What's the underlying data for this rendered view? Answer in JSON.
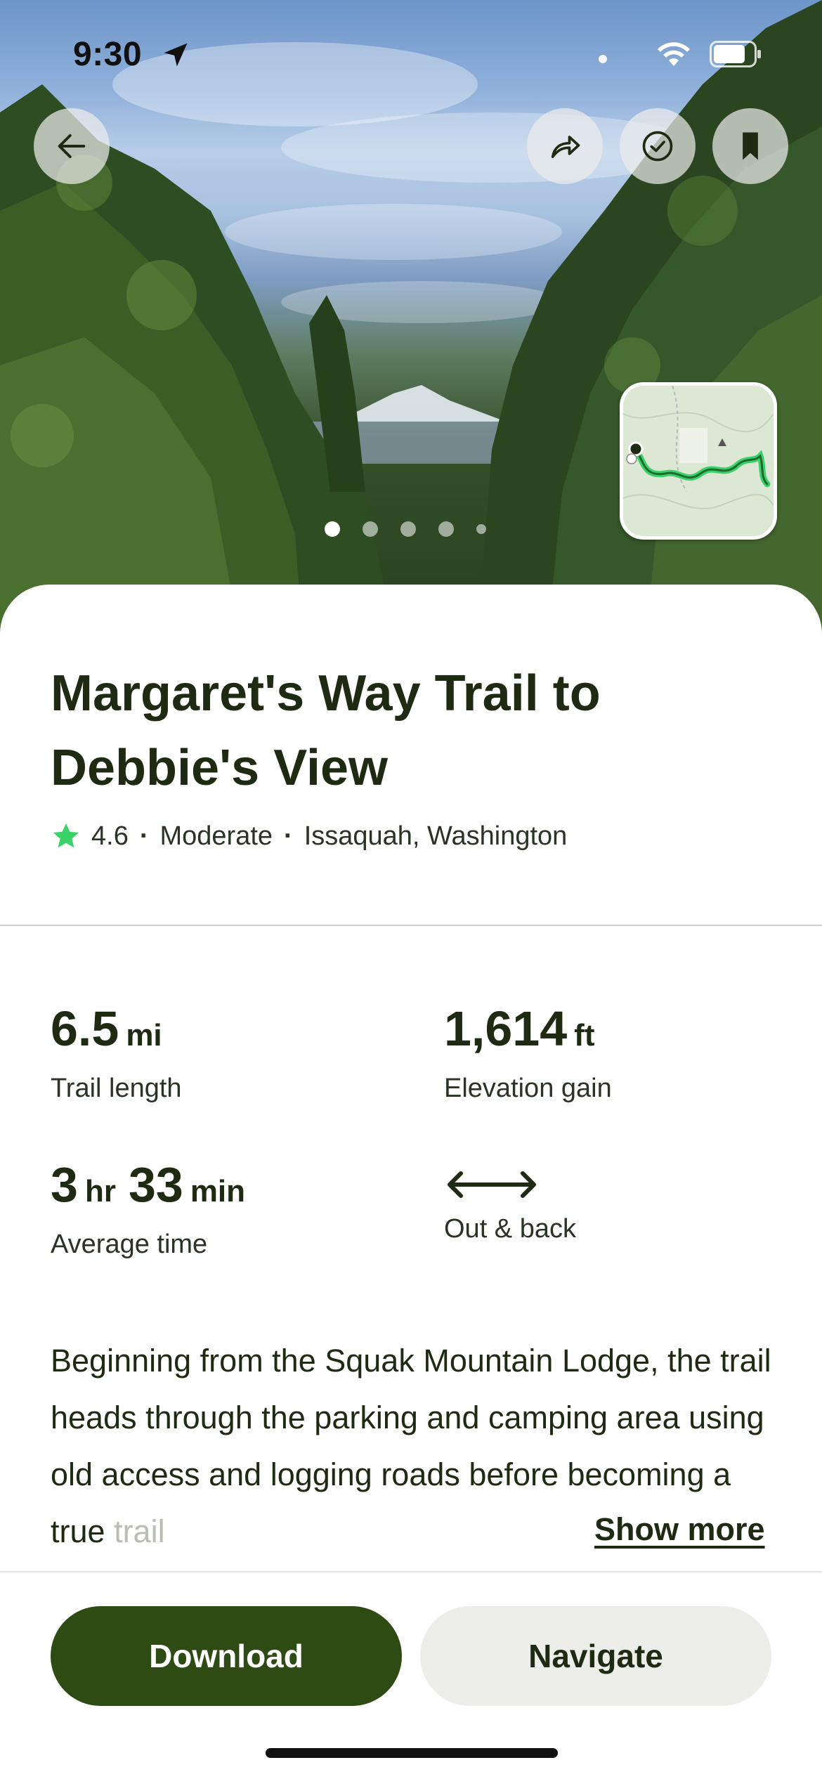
{
  "status_bar": {
    "time": "9:30"
  },
  "hero": {
    "page_indicator": {
      "count": 5,
      "active_index": 0
    }
  },
  "trail": {
    "title": "Margaret's Way Trail to Debbie's View",
    "rating": "4.6",
    "difficulty": "Moderate",
    "location": "Issaquah, Washington",
    "separator": "·"
  },
  "stats": {
    "length": {
      "value": "6.5",
      "unit": "mi",
      "label": "Trail length"
    },
    "elevation": {
      "value": "1,614",
      "unit": "ft",
      "label": "Elevation gain"
    },
    "time": {
      "hours": "3",
      "hours_unit": "hr",
      "minutes": "33",
      "minutes_unit": "min",
      "label": "Average time"
    },
    "route_type": {
      "label": "Out & back",
      "icon": "double-arrow-icon"
    }
  },
  "description": {
    "text": "Beginning from the Squak Mountain Lodge, the trail heads through the parking and camping area using old access and logging roads before becoming a true",
    "faded_text": "trail",
    "show_more_label": "Show more"
  },
  "actions": {
    "download_label": "Download",
    "navigate_label": "Navigate"
  },
  "icons": {
    "back": "back-arrow-icon",
    "share": "share-icon",
    "completed": "check-circle-icon",
    "bookmark": "bookmark-icon",
    "rating_star": "star-icon"
  },
  "colors": {
    "primary_green": "#2d4b12",
    "text_dark": "#1e2b12",
    "star_green": "#39d36a",
    "secondary_button_bg": "#ededea"
  }
}
